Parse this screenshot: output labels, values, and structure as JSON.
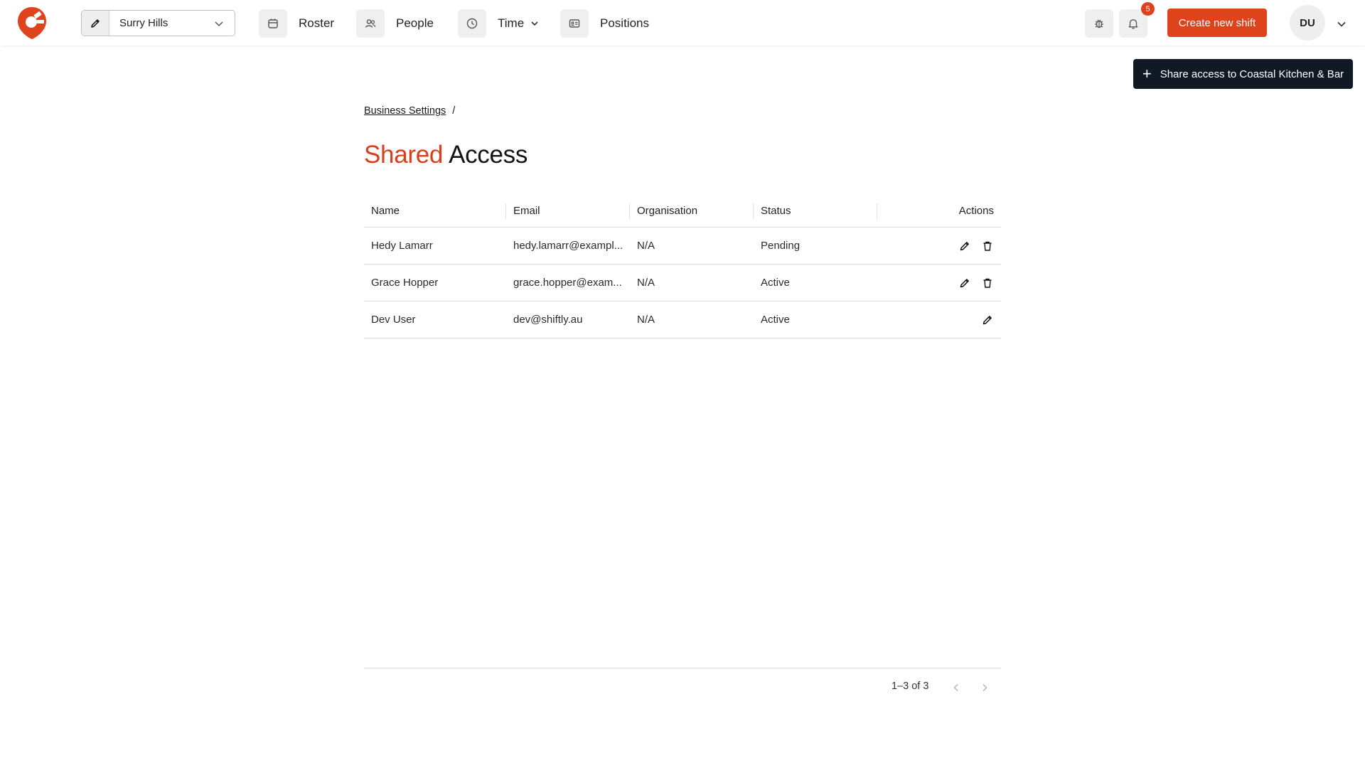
{
  "header": {
    "location": {
      "label": "Surry Hills"
    },
    "nav": [
      {
        "label": "Roster",
        "icon": "calendar-icon"
      },
      {
        "label": "People",
        "icon": "people-icon"
      },
      {
        "label": "Time",
        "icon": "clock-icon"
      },
      {
        "label": "Positions",
        "icon": "id-card-icon"
      }
    ],
    "notifications": {
      "count": "5"
    },
    "create_shift_label": "Create new shift",
    "avatar_initials": "DU"
  },
  "share_button": {
    "label": "Share access to Coastal Kitchen & Bar"
  },
  "breadcrumb": {
    "items": [
      "Business Settings"
    ],
    "separator": "/"
  },
  "title": {
    "accent": "Shared",
    "rest": "Access"
  },
  "table": {
    "columns": [
      "Name",
      "Email",
      "Organisation",
      "Status",
      "Actions"
    ],
    "rows": [
      {
        "name": "Hedy Lamarr",
        "email": "hedy.lamarr@exampl...",
        "organisation": "N/A",
        "status": "Pending"
      },
      {
        "name": "Grace Hopper",
        "email": "grace.hopper@exam...",
        "organisation": "N/A",
        "status": "Active"
      },
      {
        "name": "Dev User",
        "email": "dev@shiftly.au",
        "organisation": "N/A",
        "status": "Active"
      }
    ]
  },
  "pagination": {
    "text": "1–3 of 3"
  },
  "colors": {
    "accent": "#df431c",
    "dark": "#111a24"
  }
}
